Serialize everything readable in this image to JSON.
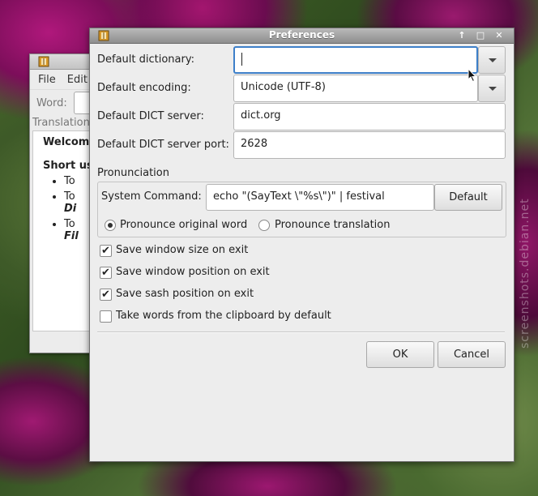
{
  "watermark": "screenshots.debian.net",
  "main_window": {
    "menu": [
      "File",
      "Edit"
    ],
    "word_label": "Word:",
    "translation_label": "Translation",
    "welcome": "Welcome",
    "short_usage": "Short us",
    "bullets": [
      {
        "line1": "To"
      },
      {
        "line1": "To",
        "line2": "Di"
      },
      {
        "line1": "To",
        "line2": "Fil"
      }
    ]
  },
  "dialog": {
    "title": "Preferences",
    "default_dictionary_label": "Default dictionary:",
    "default_dictionary_value": "",
    "default_encoding_label": "Default encoding:",
    "default_encoding_value": "Unicode (UTF-8)",
    "dict_server_label": "Default DICT server:",
    "dict_server_value": "dict.org",
    "dict_port_label": "Default DICT server port:",
    "dict_port_value": "2628",
    "pronunciation": {
      "title": "Pronunciation",
      "system_command_label": "System Command:",
      "system_command_value": "echo \"(SayText \\\"%s\\\")\" | festival",
      "default_button": "Default",
      "radio_original": "Pronounce original word",
      "radio_translation": "Pronounce translation",
      "selected": "original"
    },
    "checkboxes": [
      {
        "label": "Save window size on exit",
        "checked": true
      },
      {
        "label": "Save window position on exit",
        "checked": true
      },
      {
        "label": "Save sash position on exit",
        "checked": true
      },
      {
        "label": "Take words from the clipboard by default",
        "checked": false
      }
    ],
    "ok_button": "OK",
    "cancel_button": "Cancel",
    "wm_buttons": {
      "up": "↑",
      "maximize": "□",
      "close": "✕"
    }
  },
  "colors": {
    "focus_border": "#3d7fc9",
    "titlebar": "#9a9a9a"
  }
}
